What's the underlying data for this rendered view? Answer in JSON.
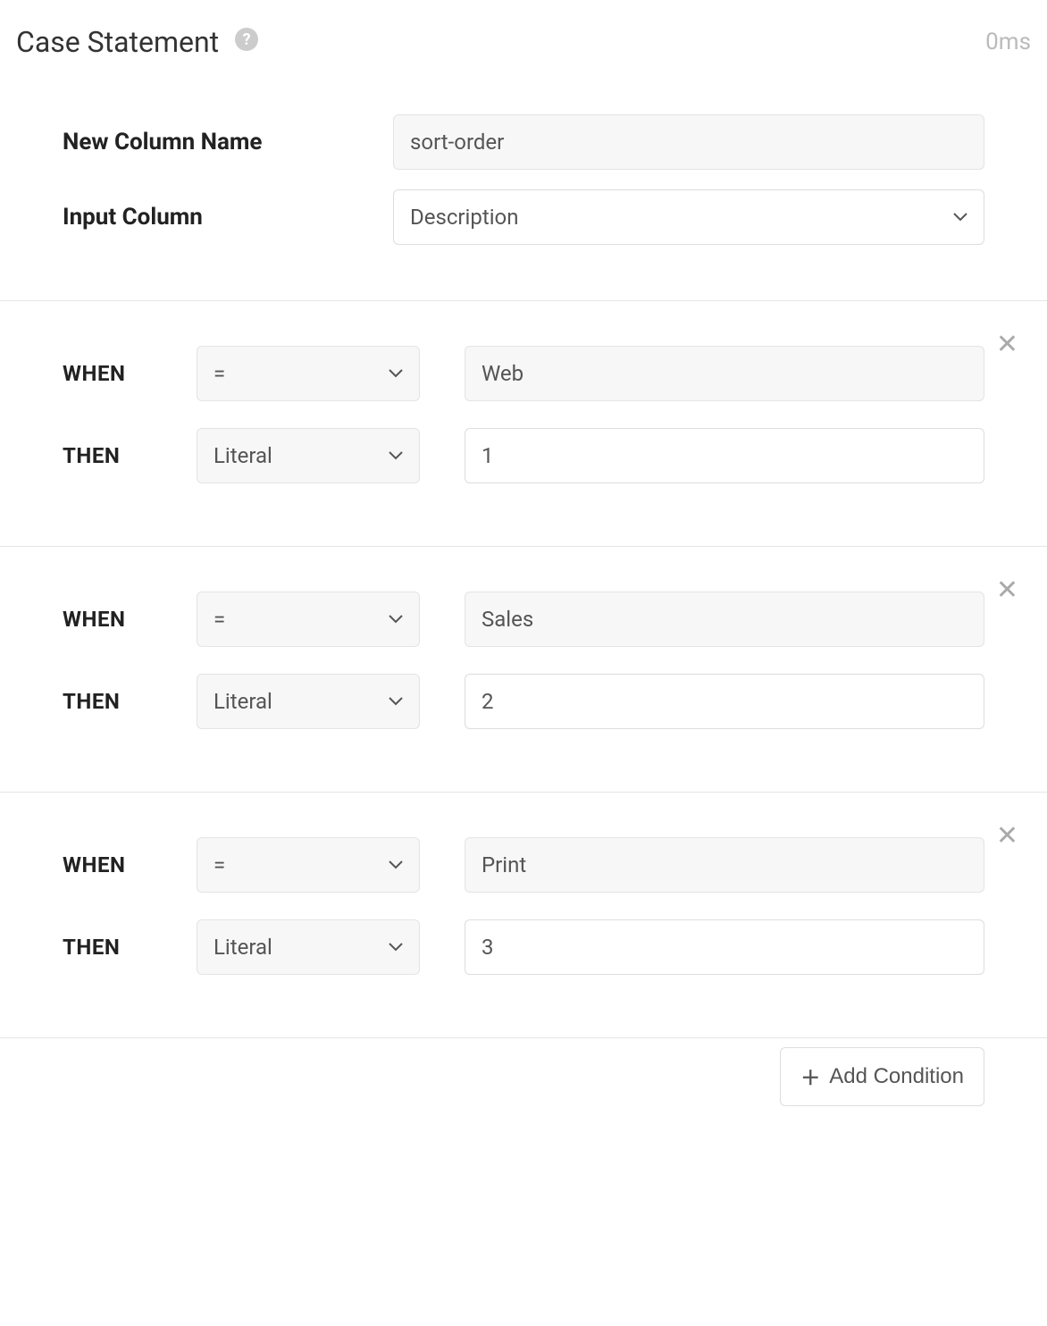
{
  "header": {
    "title": "Case Statement",
    "timing": "0ms"
  },
  "labels": {
    "new_column_name": "New Column Name",
    "input_column": "Input Column",
    "when": "WHEN",
    "then": "THEN",
    "add_condition": "Add Condition"
  },
  "fields": {
    "new_column_name_value": "sort-order",
    "input_column_value": "Description"
  },
  "conditions": [
    {
      "operator": "=",
      "when_value": "Web",
      "then_type": "Literal",
      "then_value": "1"
    },
    {
      "operator": "=",
      "when_value": "Sales",
      "then_type": "Literal",
      "then_value": "2"
    },
    {
      "operator": "=",
      "when_value": "Print",
      "then_type": "Literal",
      "then_value": "3"
    }
  ]
}
